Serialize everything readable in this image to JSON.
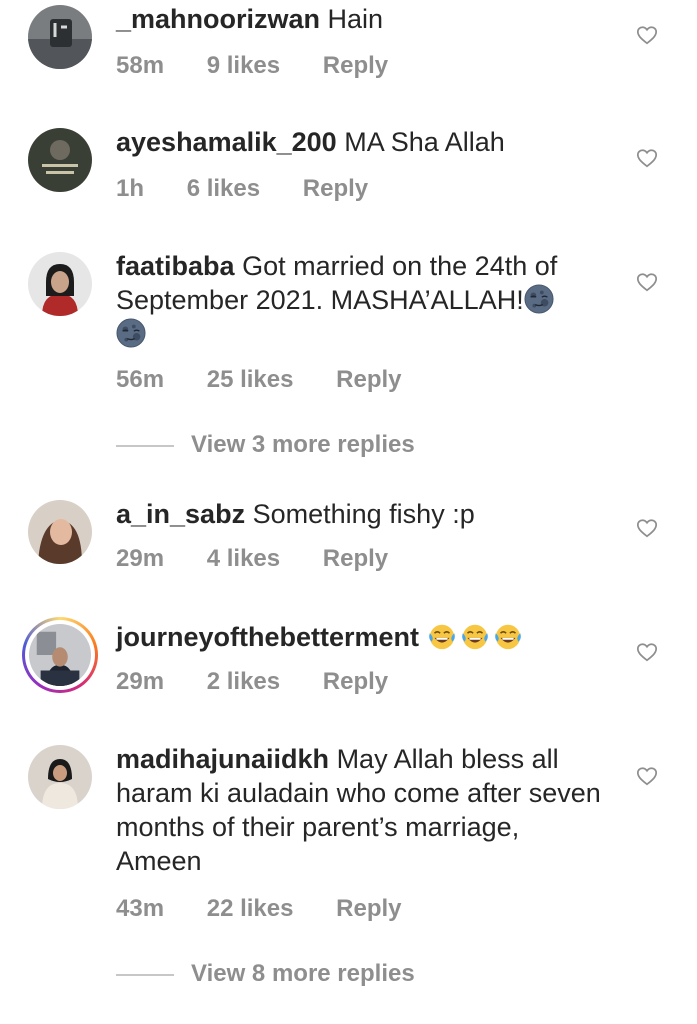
{
  "comments": [
    {
      "username": "_mahnoorizwan",
      "text": "Hain",
      "time": "58m",
      "likes": "9 likes",
      "reply": "Reply"
    },
    {
      "username": "ayeshamalik_200",
      "text": "MA Sha Allah",
      "time": "1h",
      "likes": "6 likes",
      "reply": "Reply"
    },
    {
      "username": "faatibaba",
      "text": "Got married on the 24th of September 2021. MASHA’ALLAH!",
      "time": "56m",
      "likes": "25 likes",
      "reply": "Reply",
      "view_replies": "View 3 more replies"
    },
    {
      "username": "a_in_sabz",
      "text": "Something fishy :p",
      "time": "29m",
      "likes": "4 likes",
      "reply": "Reply"
    },
    {
      "username": "journeyofthebetterment",
      "text": "",
      "time": "29m",
      "likes": "2 likes",
      "reply": "Reply"
    },
    {
      "username": "madihajunaiidkh",
      "text": "May Allah bless all haram ki auladain who come after seven months of their parent’s marriage, Ameen",
      "time": "43m",
      "likes": "22 likes",
      "reply": "Reply",
      "view_replies": "View 8 more replies"
    }
  ],
  "icons": {
    "like": "heart-outline-icon",
    "moon_emoji": "new-moon-face-emoji",
    "laugh_emoji": "tears-of-joy-emoji"
  },
  "colors": {
    "text": "#262626",
    "secondary": "#8e8e8e",
    "divider": "#c7c7c7"
  }
}
